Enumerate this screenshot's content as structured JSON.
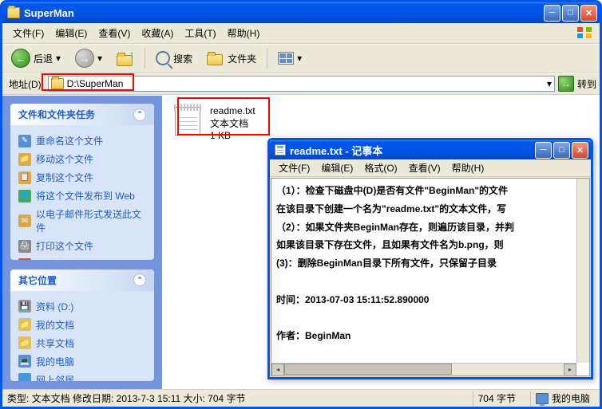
{
  "explorer": {
    "title": "SuperMan",
    "menu": {
      "file": "文件(F)",
      "edit": "编辑(E)",
      "view": "查看(V)",
      "favorites": "收藏(A)",
      "tools": "工具(T)",
      "help": "帮助(H)"
    },
    "toolbar": {
      "back": "后退",
      "search": "搜索",
      "folders": "文件夹"
    },
    "address": {
      "label": "地址(D)",
      "path": "D:\\SuperMan",
      "go": "转到"
    },
    "tasks_panel": {
      "title": "文件和文件夹任务",
      "items": [
        "重命名这个文件",
        "移动这个文件",
        "复制这个文件",
        "将这个文件发布到 Web",
        "以电子邮件形式发送此文件",
        "打印这个文件",
        "删除这个文件"
      ]
    },
    "places_panel": {
      "title": "其它位置",
      "items": [
        "资料 (D:)",
        "我的文档",
        "共享文档",
        "我的电脑",
        "网上邻居"
      ]
    },
    "file": {
      "name": "readme.txt",
      "type": "文本文档",
      "size": "1 KB"
    },
    "statusbar": {
      "left": "类型: 文本文档 修改日期: 2013-7-3 15:11 大小: 704 字节",
      "size": "704 字节",
      "location": "我的电脑"
    }
  },
  "notepad": {
    "title": "readme.txt - 记事本",
    "menu": {
      "file": "文件(F)",
      "edit": "编辑(E)",
      "format": "格式(O)",
      "view": "查看(V)",
      "help": "帮助(H)"
    },
    "lines": {
      "l1": "（1）：检查下磁盘中(D)是否有文件\"BeginMan\"的文件",
      "l2": "在该目录下创建一个名为\"readme.txt\"的文本文件，写",
      "l3": "（2）：如果文件夹BeginMan存在，则遍历该目录，并判",
      "l4": "如果该目录下存在文件，且如果有文件名为b.png，则",
      "l5": "(3)：删除BeginMan目录下所有文件，只保留子目录",
      "l6": "时间：2013-07-03 15:11:52.890000",
      "l7": "作者：BeginMan"
    }
  }
}
